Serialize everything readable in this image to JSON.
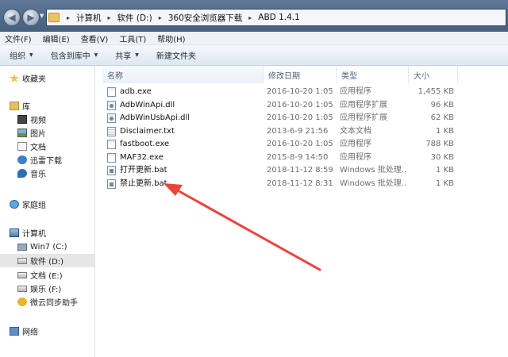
{
  "window": {
    "breadcrumb": [
      "计算机",
      "软件 (D:)",
      "360安全浏览器下载",
      "ABD 1.4.1"
    ]
  },
  "menubar": [
    "文件(F)",
    "编辑(E)",
    "查看(V)",
    "工具(T)",
    "帮助(H)"
  ],
  "toolbar": {
    "organize": "组织",
    "include_library": "包含到库中",
    "share": "共享",
    "new_folder": "新建文件夹"
  },
  "nav": {
    "favorites": "收藏夹",
    "library": "库",
    "videos": "视频",
    "pictures": "图片",
    "documents": "文档",
    "thunder": "迅雷下载",
    "music": "音乐",
    "homegroup": "家庭组",
    "computer": "计算机",
    "drive_c": "Win7 (C:)",
    "drive_d": "软件 (D:)",
    "drive_e": "文档 (E:)",
    "drive_f": "娱乐 (F:)",
    "weiyun": "微云同步助手",
    "network": "网络"
  },
  "columns": {
    "name": "名称",
    "date": "修改日期",
    "type": "类型",
    "size": "大小"
  },
  "files": [
    {
      "name": "adb.exe",
      "date": "2016-10-20 1:05",
      "type": "应用程序",
      "size": "1,455 KB",
      "icon": "exe"
    },
    {
      "name": "AdbWinApi.dll",
      "date": "2016-10-20 1:05",
      "type": "应用程序扩展",
      "size": "96 KB",
      "icon": "dll"
    },
    {
      "name": "AdbWinUsbApi.dll",
      "date": "2016-10-20 1:05",
      "type": "应用程序扩展",
      "size": "62 KB",
      "icon": "dll"
    },
    {
      "name": "Disclaimer.txt",
      "date": "2013-6-9 21:56",
      "type": "文本文档",
      "size": "1 KB",
      "icon": "txt"
    },
    {
      "name": "fastboot.exe",
      "date": "2016-10-20 1:05",
      "type": "应用程序",
      "size": "788 KB",
      "icon": "exe"
    },
    {
      "name": "MAF32.exe",
      "date": "2015-8-9 14:50",
      "type": "应用程序",
      "size": "30 KB",
      "icon": "exe"
    },
    {
      "name": "打开更新.bat",
      "date": "2018-11-12 8:59",
      "type": "Windows 批处理...",
      "size": "1 KB",
      "icon": "bat"
    },
    {
      "name": "禁止更新.bat",
      "date": "2018-11-12 8:31",
      "type": "Windows 批处理...",
      "size": "1 KB",
      "icon": "bat"
    }
  ],
  "colors": {
    "annotation_arrow": "#e8453c",
    "title_bar": "#4f6a8a",
    "selected_nav": "#e6e6e6"
  }
}
